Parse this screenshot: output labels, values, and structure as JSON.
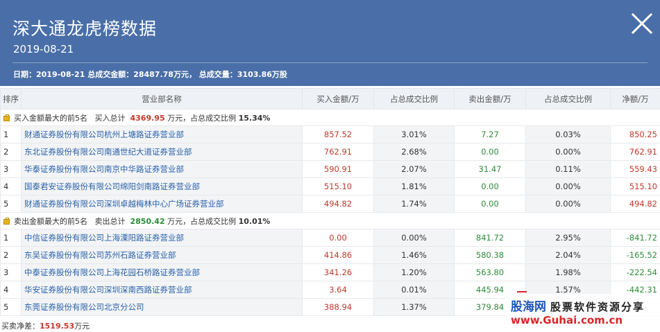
{
  "header": {
    "title": "深大通龙虎榜数据",
    "date": "2019-08-21",
    "summary": "日期：2019-08-21 总成交金额：28487.78万元， 总成交量：3103.86万股"
  },
  "table": {
    "columns": [
      "排序",
      "营业部名称",
      "买入金额/万",
      "占总成交比例",
      "卖出金额/万",
      "占总成交比例",
      "净额/万"
    ],
    "buy_group": {
      "label": "买入金额最大的前5名",
      "total_label": "买入总计",
      "total_value": "4369.95",
      "unit_text": "万元，占总成交比例",
      "ratio": "15.34%"
    },
    "buy_rows": [
      {
        "rank": "1",
        "name": "财通证券股份有限公司杭州上塘路证券营业部",
        "buy": "857.52",
        "buy_ratio": "3.01%",
        "sell": "7.27",
        "sell_ratio": "0.03%",
        "net": "850.25"
      },
      {
        "rank": "2",
        "name": "东北证券股份有限公司南通世纪大道证券营业部",
        "buy": "762.91",
        "buy_ratio": "2.68%",
        "sell": "0.00",
        "sell_ratio": "0.00%",
        "net": "762.91"
      },
      {
        "rank": "3",
        "name": "华泰证券股份有限公司南京中华路证券营业部",
        "buy": "590.91",
        "buy_ratio": "2.07%",
        "sell": "31.47",
        "sell_ratio": "0.11%",
        "net": "559.43"
      },
      {
        "rank": "4",
        "name": "国泰君安证券股份有限公司绵阳剑南路证券营业部",
        "buy": "515.10",
        "buy_ratio": "1.81%",
        "sell": "0.00",
        "sell_ratio": "0.00%",
        "net": "515.10"
      },
      {
        "rank": "5",
        "name": "财通证券股份有限公司深圳卓越梅林中心广场证券营业部",
        "buy": "494.82",
        "buy_ratio": "1.74%",
        "sell": "0.00",
        "sell_ratio": "0.00%",
        "net": "494.82"
      }
    ],
    "sell_group": {
      "label": "卖出金额最大的前5名",
      "total_label": "卖出总计",
      "total_value": "2850.42",
      "unit_text": "万元，占总成交比例",
      "ratio": "10.01%"
    },
    "sell_rows": [
      {
        "rank": "1",
        "name": "中信证券股份有限公司上海溧阳路证券营业部",
        "buy": "0.00",
        "buy_ratio": "0.00%",
        "sell": "841.72",
        "sell_ratio": "2.95%",
        "net": "-841.72"
      },
      {
        "rank": "2",
        "name": "东吴证券股份有限公司苏州石路证券营业部",
        "buy": "414.86",
        "buy_ratio": "1.46%",
        "sell": "580.38",
        "sell_ratio": "2.04%",
        "net": "-165.52"
      },
      {
        "rank": "3",
        "name": "中泰证券股份有限公司上海花园石桥路证券营业部",
        "buy": "341.26",
        "buy_ratio": "1.20%",
        "sell": "563.80",
        "sell_ratio": "1.98%",
        "net": "-222.54"
      },
      {
        "rank": "4",
        "name": "华安证券股份有限公司深圳深南西路证券营业部",
        "buy": "3.64",
        "buy_ratio": "0.01%",
        "sell": "445.94",
        "sell_ratio": "1.57%",
        "net": "-442.31"
      },
      {
        "rank": "5",
        "name": "东莞证券股份有限公司北京分公司",
        "buy": "388.94",
        "buy_ratio": "1.37%",
        "sell": "379.84",
        "sell_ratio": "",
        "net": ""
      }
    ]
  },
  "footer": {
    "label": "买卖净差：",
    "value": "1519.53",
    "unit": "万元"
  },
  "watermark": {
    "brand": "股海网",
    "slogan": "股票软件资源分享",
    "url": "www.Guhai.com.cn"
  },
  "colors": {
    "header_bg": "#4a6fa8",
    "up": "#c0392b",
    "down": "#2e8b3a",
    "link": "#2a62a8"
  },
  "icons": [
    "close-icon",
    "folder-icon"
  ]
}
